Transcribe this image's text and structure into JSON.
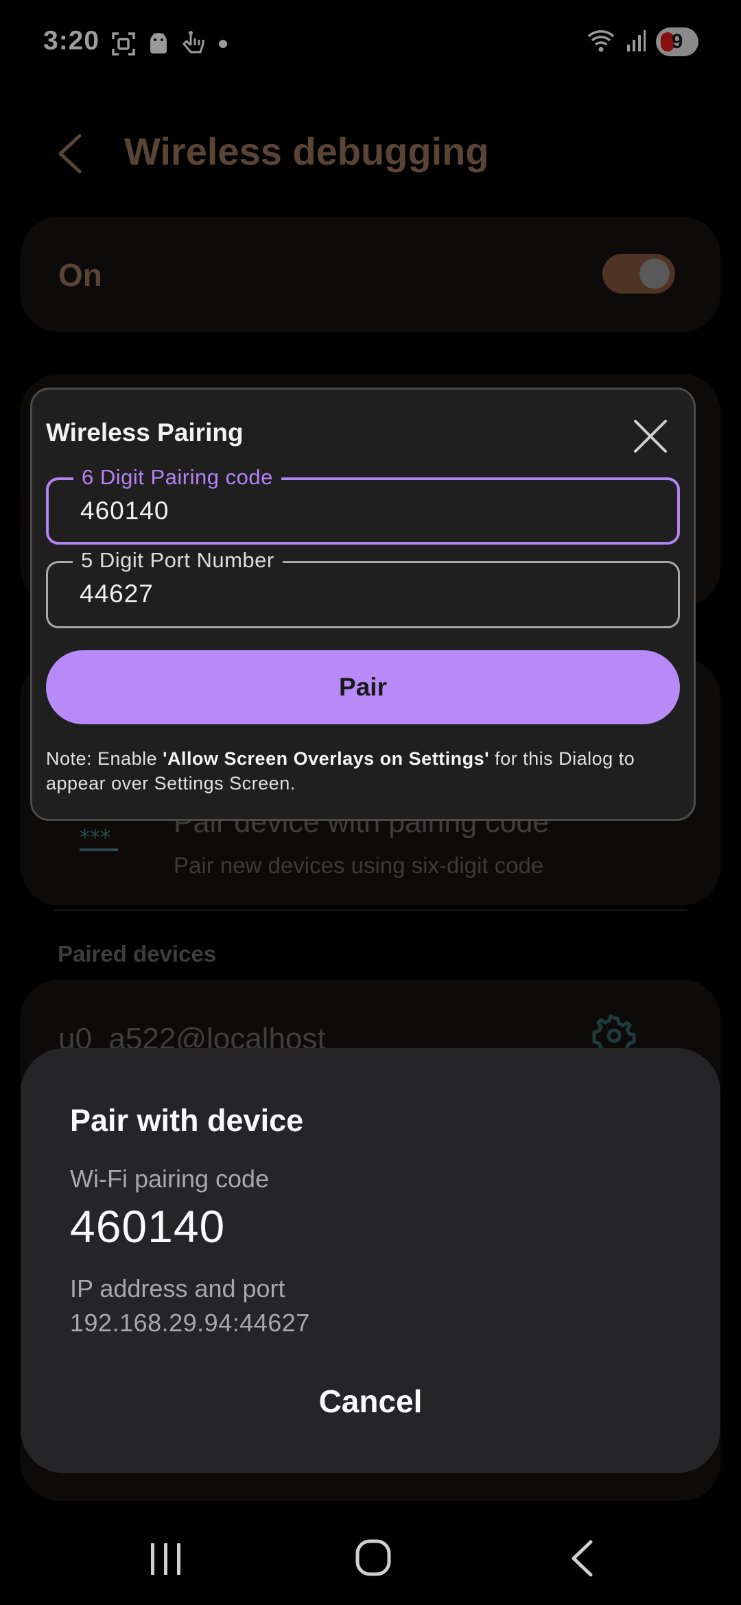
{
  "status_bar": {
    "time": "3:20",
    "battery_level": "9",
    "left_icons": [
      "screenshot-icon",
      "android-icon",
      "hand-icon",
      "dot-icon"
    ],
    "right_icons": [
      "wifi-icon",
      "signal-icon",
      "battery-icon"
    ]
  },
  "app_bar": {
    "title": "Wireless debugging"
  },
  "main_toggle": {
    "label": "On",
    "state": true
  },
  "pair_code_item": {
    "title": "Pair device with pairing code",
    "subtitle": "Pair new devices using six-digit code"
  },
  "paired_devices": {
    "section_label": "Paired devices",
    "items": [
      {
        "name": "u0_a522@localhost"
      }
    ]
  },
  "wireless_pairing_dialog": {
    "title": "Wireless Pairing",
    "code_field": {
      "label": "6 Digit Pairing code",
      "value": "460140"
    },
    "port_field": {
      "label": "5 Digit Port Number",
      "value": "44627"
    },
    "pair_button": "Pair",
    "note_prefix": "Note: Enable ",
    "note_bold": "'Allow Screen Overlays on Settings'",
    "note_suffix": " for this Dialog to appear over Settings Screen."
  },
  "pair_sheet": {
    "title": "Pair with device",
    "code_label": "Wi-Fi pairing code",
    "code": "460140",
    "ip_label": "IP address and port",
    "ip": "192.168.29.94:44627",
    "cancel": "Cancel"
  },
  "colors": {
    "accent": "#b88af7",
    "toggle_track": "#4f3424",
    "sheet_bg": "#252527",
    "dialog_bg": "#1f1f1f"
  }
}
